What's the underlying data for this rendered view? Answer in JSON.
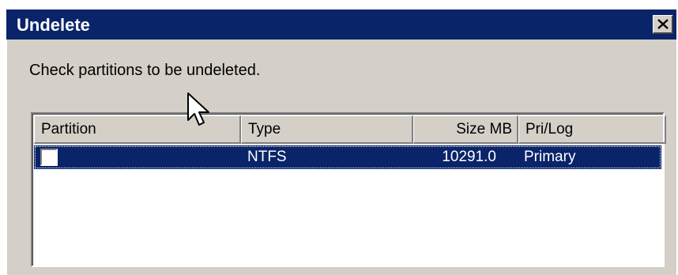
{
  "window": {
    "title": "Undelete"
  },
  "close_button": {
    "glyph": "✕"
  },
  "instruction": "Check partitions to be undeleted.",
  "list": {
    "columns": [
      "Partition",
      "Type",
      "Size MB",
      "Pri/Log"
    ],
    "rows": [
      {
        "partition": "",
        "checked": false,
        "type": "NTFS",
        "size_mb": "10291.0",
        "pri_log": "Primary"
      }
    ]
  },
  "colors": {
    "titlebar": "#0a246a",
    "selection": "#0a246a",
    "face": "#d4d0c8"
  }
}
